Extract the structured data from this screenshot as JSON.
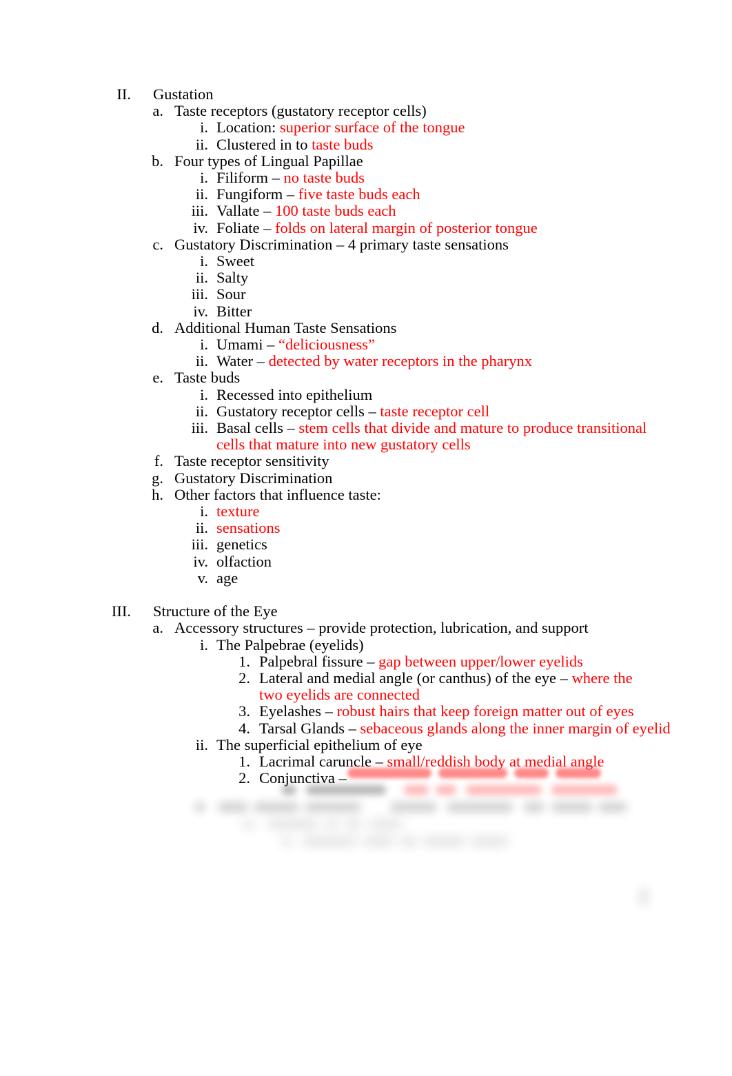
{
  "document": {
    "type": "lecture-outline",
    "colors": {
      "text": "#000000",
      "annotation_red": "#ff0000",
      "page_background": "#ffffff"
    },
    "sections": [
      {
        "marker": "II.",
        "title": "Gustation",
        "items": [
          {
            "marker": "a.",
            "text": "Taste receptors (gustatory receptor cells)",
            "items": [
              {
                "marker": "i.",
                "text": "Location: ",
                "red": "superior surface of the tongue"
              },
              {
                "marker": "ii.",
                "text": "Clustered in to ",
                "red": "taste buds"
              }
            ]
          },
          {
            "marker": "b.",
            "text": "Four types of Lingual Papillae",
            "items": [
              {
                "marker": "i.",
                "text": "Filiform – ",
                "red": "no taste buds"
              },
              {
                "marker": "ii.",
                "text": "Fungiform – ",
                "red": "five taste buds each"
              },
              {
                "marker": "iii.",
                "text": "Vallate – ",
                "red": "100 taste buds each"
              },
              {
                "marker": "iv.",
                "text": "Foliate – ",
                "red": "folds on lateral margin of posterior tongue"
              }
            ]
          },
          {
            "marker": "c.",
            "text": "Gustatory Discrimination – 4 primary taste sensations",
            "items": [
              {
                "marker": "i.",
                "text": "Sweet"
              },
              {
                "marker": "ii.",
                "text": "Salty"
              },
              {
                "marker": "iii.",
                "text": "Sour"
              },
              {
                "marker": "iv.",
                "text": "Bitter"
              }
            ]
          },
          {
            "marker": "d.",
            "text": "Additional Human Taste Sensations",
            "items": [
              {
                "marker": "i.",
                "text": "Umami – ",
                "red": "“deliciousness”"
              },
              {
                "marker": "ii.",
                "text": "Water – ",
                "red": "detected by water receptors in the pharynx"
              }
            ]
          },
          {
            "marker": "e.",
            "text": "Taste buds",
            "items": [
              {
                "marker": "i.",
                "text": "Recessed into epithelium"
              },
              {
                "marker": "ii.",
                "text": "Gustatory receptor cells – ",
                "red": "taste receptor cell"
              },
              {
                "marker": "iii.",
                "text": "Basal cells – ",
                "red": "stem cells that divide and mature to produce transitional cells that mature into new gustatory cells"
              }
            ]
          },
          {
            "marker": "f.",
            "text": "Taste receptor sensitivity"
          },
          {
            "marker": "g.",
            "text": "Gustatory Discrimination"
          },
          {
            "marker": "h.",
            "text": "Other factors that influence taste:",
            "items": [
              {
                "marker": "i.",
                "text": "",
                "red": "texture"
              },
              {
                "marker": "ii.",
                "text": "",
                "red": "sensations"
              },
              {
                "marker": "iii.",
                "text": "genetics"
              },
              {
                "marker": "iv.",
                "text": "olfaction"
              },
              {
                "marker": "v.",
                "text": "age"
              }
            ]
          }
        ]
      },
      {
        "marker": "III.",
        "title": "Structure of the Eye",
        "items": [
          {
            "marker": "a.",
            "text": "Accessory structures – provide protection, lubrication, and support",
            "items": [
              {
                "marker": "i.",
                "text": "The Palpebrae   (eyelids)",
                "items": [
                  {
                    "marker": "1.",
                    "text": "Palpebral fissure – ",
                    "red": "gap between upper/lower eyelids"
                  },
                  {
                    "marker": "2.",
                    "text": "Lateral and medial angle (or canthus) of the eye – ",
                    "red": "where the two eyelids are connected"
                  },
                  {
                    "marker": "3.",
                    "text": "Eyelashes – ",
                    "red": "robust hairs that keep foreign matter out of eyes"
                  },
                  {
                    "marker": "4.",
                    "text": "Tarsal Glands – ",
                    "red": "sebaceous glands along the inner margin of eyelid"
                  }
                ]
              },
              {
                "marker": "ii.",
                "text": "The superficial epithelium of eye",
                "items": [
                  {
                    "marker": "1.",
                    "text": "Lacrimal caruncle – ",
                    "red": "small/reddish body at medial angle"
                  },
                  {
                    "marker": "2.",
                    "text": "Conjunctiva – ",
                    "red": ""
                  }
                ]
              }
            ]
          }
        ]
      }
    ],
    "illegible_region": {
      "note": "Lower portion of the page is blurred beyond legibility",
      "visible_partial_text": "Conjunctiva –"
    }
  }
}
